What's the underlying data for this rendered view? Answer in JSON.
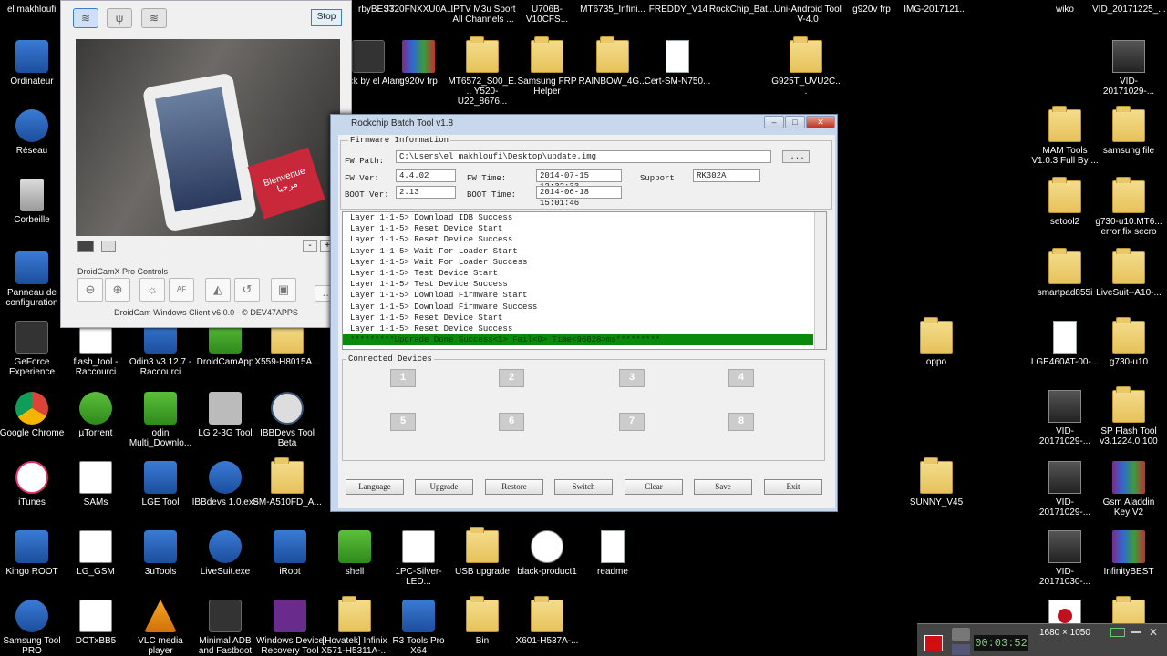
{
  "top_row": [
    "rbyBEST",
    "J320FNXXU0A...",
    "IPTV M3u Sport All Channels ...",
    "U706B-V10CFS...",
    "MT6735_Infini...",
    "FREDDY_V14",
    "RockChip_Bat...",
    "Uni-Android Tool V-4.0",
    "g920v frp",
    "IMG-2017121...",
    "wiko",
    "VID_20171225_..."
  ],
  "icons_left": [
    {
      "label": "Ordinateur"
    },
    {
      "label": "Réseau"
    },
    {
      "label": "Corbeille"
    },
    {
      "label": "Panneau de configuration"
    },
    {
      "label": "GeForce Experience"
    },
    {
      "label": "Google Chrome"
    },
    {
      "label": "iTunes"
    },
    {
      "label": "Kingo ROOT"
    },
    {
      "label": "Samsung Tool PRO"
    }
  ],
  "icons_grid": [
    {
      "label": "flash_tool - Raccourci"
    },
    {
      "label": "Odin3 v3.12.7 - Raccourci"
    },
    {
      "label": "DroidCamApp"
    },
    {
      "label": "X559-H8015A..."
    },
    {
      "label": "µTorrent"
    },
    {
      "label": "odin Multi_Downlo..."
    },
    {
      "label": "LG 2-3G Tool"
    },
    {
      "label": "IBBDevs Tool Beta"
    },
    {
      "label": "SAMs"
    },
    {
      "label": "LGE Tool"
    },
    {
      "label": "IBBdevs 1.0.exe"
    },
    {
      "label": "SM-A510FD_A..."
    },
    {
      "label": "LG_GSM"
    },
    {
      "label": "3uTools"
    },
    {
      "label": "LiveSuit.exe"
    },
    {
      "label": "iRoot"
    },
    {
      "label": "shell"
    },
    {
      "label": "1PC-Silver-LED..."
    },
    {
      "label": "USB upgrade"
    },
    {
      "label": "black-product1"
    },
    {
      "label": "readme"
    },
    {
      "label": "DCTxBB5"
    },
    {
      "label": "VLC media player"
    },
    {
      "label": "Minimal ADB and Fastboot"
    },
    {
      "label": "Windows Device Recovery Tool"
    },
    {
      "label": "[Hovatek] Infinix X571-H5311A-..."
    },
    {
      "label": "R3 Tools Pro X64"
    },
    {
      "label": "Bin"
    },
    {
      "label": "X601-H537A-..."
    }
  ],
  "icons_upper": [
    {
      "label": "Crack by el Alam"
    },
    {
      "label": "g920v frp"
    },
    {
      "label": "MT6572_S00_E... Y520-U22_8676..."
    },
    {
      "label": "Samsung FRP Helper"
    },
    {
      "label": "RAINBOW_4G..."
    },
    {
      "label": "Cert-SM-N750..."
    },
    {
      "label": "G925T_UVU2C..."
    }
  ],
  "icons_right": [
    {
      "label": "VID-20171029-..."
    },
    {
      "label": "MAM Tools V1.0.3 Full By ..."
    },
    {
      "label": "samsung file"
    },
    {
      "label": "setool2"
    },
    {
      "label": "g730-u10.MT6... error fix secro"
    },
    {
      "label": "smartpad855i"
    },
    {
      "label": "LiveSuit--A10-..."
    },
    {
      "label": "oppo"
    },
    {
      "label": "LGE460AT-00-..."
    },
    {
      "label": "g730-u10"
    },
    {
      "label": "VID-20171029-..."
    },
    {
      "label": "SP Flash Tool v3.1224.0.100"
    },
    {
      "label": "SUNNY_V45"
    },
    {
      "label": "VID-20171029-..."
    },
    {
      "label": "Gsm Aladdin Key V2"
    },
    {
      "label": "VID-20171030-..."
    },
    {
      "label": "InfinityBEST"
    }
  ],
  "droidcam": {
    "stop_label": "Stop",
    "pro_label": "DroidCamX Pro Controls",
    "footer": "DroidCam Windows Client v6.0.0 - © DEV47APPS",
    "card_text": "Bienvenue مرحبا",
    "zoom_minus": "-",
    "zoom_plus": "+",
    "dots": "...",
    "af": "AF"
  },
  "rockchip": {
    "title": "Rockchip Batch Tool v1.8",
    "group": "Firmware Information",
    "fw_path_label": "FW Path:",
    "fw_path": "C:\\Users\\el makhloufi\\Desktop\\update.img",
    "browse": "...",
    "fw_ver_label": "FW Ver:",
    "fw_ver": "4.4.02",
    "fw_time_label": "FW Time:",
    "fw_time": "2014-07-15 12:32:33",
    "support_label": "Support",
    "support": "RK302A",
    "boot_ver_label": "BOOT Ver:",
    "boot_ver": "2.13",
    "boot_time_label": "BOOT Time:",
    "boot_time": "2014-06-18 15:01:46",
    "log": [
      "Layer 1-1-5> Download IDB Success",
      "Layer 1-1-5> Reset Device Start",
      "Layer 1-1-5> Reset Device Success",
      "Layer 1-1-5> Wait For Loader Start",
      "Layer 1-1-5> Wait For Loader Success",
      "Layer 1-1-5> Test Device Start",
      "Layer 1-1-5> Test Device Success",
      "Layer 1-1-5> Download Firmware Start",
      "Layer 1-1-5> Download Firmware Success",
      "Layer 1-1-5> Reset Device Start",
      "Layer 1-1-5> Reset Device Success"
    ],
    "status_line": "*********Upgrade Done Success<1> Fail<0> Time<96828>ms*********",
    "devices_label": "Connected Devices",
    "devices": [
      "1",
      "2",
      "3",
      "4",
      "5",
      "6",
      "7",
      "8"
    ],
    "buttons": [
      "Language",
      "Upgrade",
      "Restore",
      "Switch",
      "Clear",
      "Save",
      "Exit"
    ]
  },
  "recorder": {
    "resolution": "1680 × 1050",
    "timer": "00:03:52"
  },
  "colors": {
    "log_success_bar": "#0a8a0a",
    "window_frame": "#c8d8ec",
    "record_button": "#d01010"
  }
}
